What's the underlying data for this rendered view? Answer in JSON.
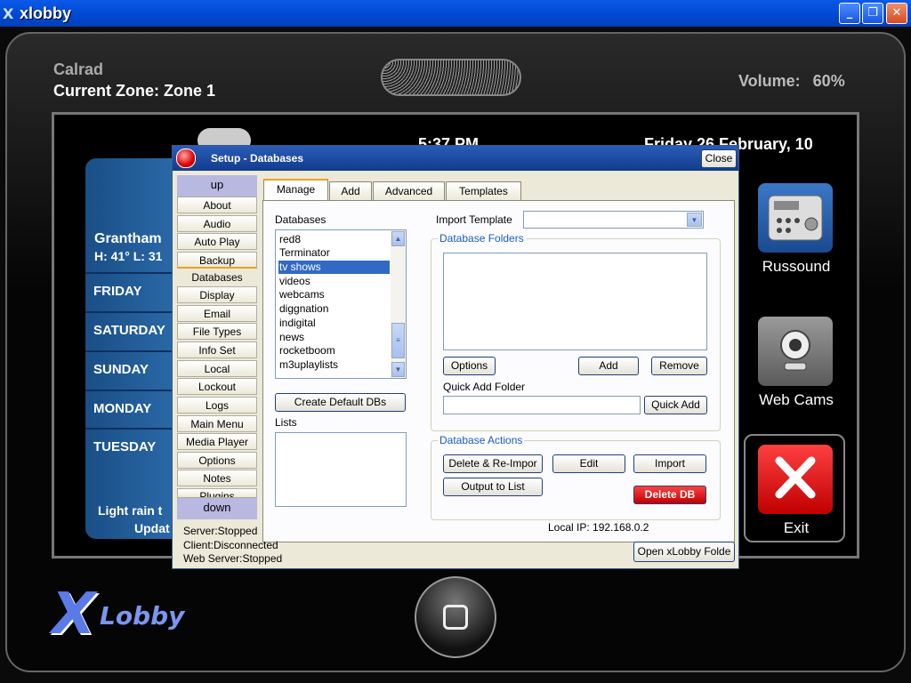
{
  "window": {
    "title": "xlobby",
    "icon": "x-logo-icon",
    "buttons": [
      "minimize-icon",
      "restore-icon",
      "close-icon"
    ]
  },
  "header": {
    "brand": "Calrad",
    "zone": "Current Zone: Zone 1",
    "volume_label": "Volume:",
    "volume_value": "60%"
  },
  "screen": {
    "time": "5:37 PM",
    "date": "Friday 26 February, 10",
    "weather": {
      "location": "Grantham",
      "highlow": "H: 41°  L: 31",
      "days": [
        "FRIDAY",
        "SATURDAY",
        "SUNDAY",
        "MONDAY",
        "TUESDAY"
      ],
      "condition": "Light rain t",
      "updated": "Updat"
    },
    "tiles": [
      {
        "label": "Russound",
        "icon": "remote-control-icon"
      },
      {
        "label": "Web Cams",
        "icon": "webcam-icon"
      },
      {
        "label": "Exit",
        "icon": "exit-x-icon"
      }
    ]
  },
  "logo": {
    "x": "X",
    "text": "Lobby"
  },
  "dialog": {
    "title": "Setup - Databases",
    "close": "Close",
    "sidebar": {
      "up": "up",
      "down": "down",
      "items": [
        "About",
        "Audio",
        "Auto Play",
        "Backup",
        "Databases",
        "Display",
        "Email",
        "File Types",
        "Info Set",
        "Local",
        "Lockout",
        "Logs",
        "Main Menu",
        "Media Player",
        "Options",
        "Notes",
        "Plugins"
      ],
      "active": "Databases"
    },
    "tabs": [
      "Manage",
      "Add",
      "Advanced",
      "Templates"
    ],
    "active_tab": "Manage",
    "databases_label": "Databases",
    "databases": [
      "red8",
      "Terminator",
      "tv shows",
      "videos",
      "webcams",
      "diggnation",
      "indigital",
      "news",
      "rocketboom",
      "m3uplaylists"
    ],
    "selected_database": "tv shows",
    "create_default": "Create Default DBs",
    "lists_label": "Lists",
    "import_template_label": "Import Template",
    "import_template_value": "",
    "folders_group": "Database Folders",
    "options_btn": "Options",
    "add_btn": "Add",
    "remove_btn": "Remove",
    "quick_add_label": "Quick Add Folder",
    "quick_add_value": "",
    "quick_add_btn": "Quick Add",
    "actions_group": "Database Actions",
    "delete_reimport": "Delete & Re-Impor",
    "edit": "Edit",
    "import": "Import",
    "output_to_list": "Output to List",
    "delete_db": "Delete DB",
    "status": {
      "server": "Server:Stopped",
      "client": "Client:Disconnected",
      "web": "Web Server:Stopped"
    },
    "local_ip": "Local IP:  192.168.0.2",
    "open_folder": "Open xLobby Folde"
  }
}
